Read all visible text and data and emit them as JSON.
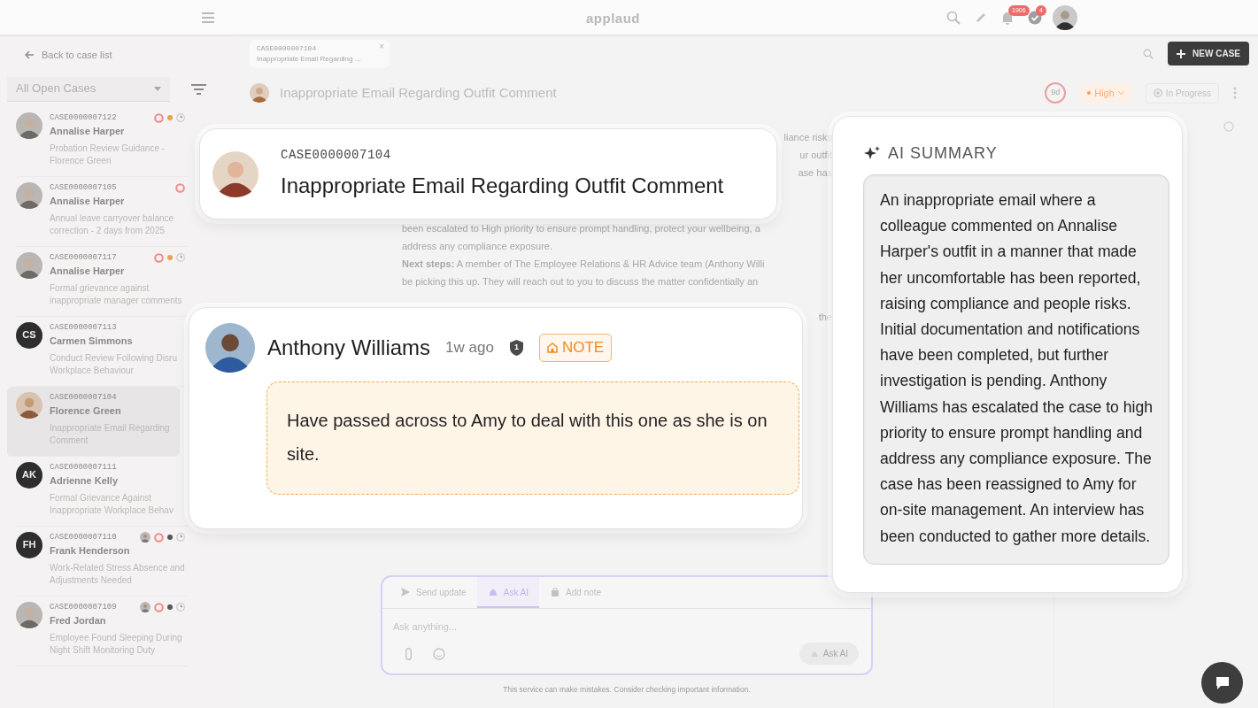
{
  "topbar": {
    "logo": "applaud",
    "notification_count": "1906",
    "task_count": "4"
  },
  "sidebar": {
    "back_link": "Back to case list",
    "filter": "All Open Cases",
    "cases": [
      {
        "case_number": "CASE0000007122",
        "name": "Annalise Harper",
        "description_lines": [
          "Probation Review Guidance -",
          "Florence Green"
        ],
        "avatar": {
          "kind": "photo"
        },
        "selected": false,
        "markers": [
          {
            "kind": "ring"
          },
          {
            "kind": "dot",
            "color": "#f0a04b"
          },
          {
            "kind": "clock"
          }
        ]
      },
      {
        "case_number": "CASE0000007105",
        "name": "Annalise Harper",
        "description_lines": [
          "Annual leave carryover balance",
          "correction - 2 days from 2025"
        ],
        "avatar": {
          "kind": "photo"
        },
        "selected": false,
        "markers": [
          {
            "kind": "ring"
          }
        ]
      },
      {
        "case_number": "CASE0000007117",
        "name": "Annalise Harper",
        "description_lines": [
          "Formal grievance against",
          "inappropriate manager comments"
        ],
        "avatar": {
          "kind": "photo"
        },
        "selected": false,
        "markers": [
          {
            "kind": "ring"
          },
          {
            "kind": "dot",
            "color": "#f0a04b"
          },
          {
            "kind": "clock"
          }
        ]
      },
      {
        "case_number": "CASE0000007113",
        "name": "Carmen Simmons",
        "description_lines": [
          "Conduct Review Following Disru",
          "Workplace Behaviour"
        ],
        "avatar": {
          "kind": "initials",
          "text": "CS"
        },
        "selected": false
      },
      {
        "case_number": "CASE0000007104",
        "name": "Florence Green",
        "description_lines": [
          "Inappropriate Email Regarding",
          "Comment"
        ],
        "avatar": {
          "kind": "photo"
        },
        "selected": true
      },
      {
        "case_number": "CASE0000007111",
        "name": "Adrienne Kelly",
        "description_lines": [
          "Formal Grievance Against",
          "Inappropriate Workplace Behav"
        ],
        "avatar": {
          "kind": "initials",
          "text": "AK"
        },
        "selected": false
      },
      {
        "case_number": "CASE0000007110",
        "name": "Frank Henderson",
        "description_lines": [
          "Work-Related Stress Absence and",
          "Adjustments Needed"
        ],
        "avatar": {
          "kind": "initials",
          "text": "FH"
        },
        "selected": false,
        "markers": [
          {
            "kind": "person"
          },
          {
            "kind": "ring"
          },
          {
            "kind": "dot",
            "color": "#555555"
          },
          {
            "kind": "clock"
          }
        ]
      },
      {
        "case_number": "CASE0000007109",
        "name": "Fred Jordan",
        "description_lines": [
          "Employee Found Sleeping During",
          "Night Shift Monitoring Duty"
        ],
        "avatar": {
          "kind": "photo"
        },
        "selected": false,
        "markers": [
          {
            "kind": "person"
          },
          {
            "kind": "ring"
          },
          {
            "kind": "dot",
            "color": "#555555"
          },
          {
            "kind": "clock"
          }
        ]
      }
    ]
  },
  "tab": {
    "case_number": "CASE0000007104",
    "title": "Inappropriate Email Regarding ...",
    "close": "×"
  },
  "new_case_button": "NEW CASE",
  "case_header": {
    "title": "Inappropriate Email Regarding Outfit Comment",
    "age": "9d",
    "priority": "High",
    "status": "In Progress"
  },
  "message_lines": [
    {
      "kind": "fragment",
      "text": "liance risks"
    },
    {
      "kind": "fragment",
      "text": "ur outfit"
    },
    {
      "kind": "fragment",
      "text": "ase has"
    },
    {
      "kind": "line",
      "text": "been escalated to High priority to ensure prompt handling, protect your wellbeing, a"
    },
    {
      "kind": "line",
      "text": "address any compliance exposure."
    },
    {
      "kind": "line",
      "text": "**Next steps:** A member of The Employee Relations & HR Advice team (Anthony Willi"
    },
    {
      "kind": "line",
      "text": "be picking this up. They will reach out to you to discuss the matter confidentially an"
    },
    {
      "kind": "fragment",
      "text": "the"
    }
  ],
  "composer": {
    "tabs": [
      {
        "label": "Send update",
        "selected": false
      },
      {
        "label": "Ask AI",
        "selected": true
      },
      {
        "label": "Add note",
        "selected": false
      }
    ],
    "placeholder": "Ask anything...",
    "submit": {
      "label": "Ask AI",
      "disabled": true
    }
  },
  "disclaimer": "This service can make mistakes. Consider checking important information.",
  "case_card": {
    "case_number": "CASE0000007104",
    "title": "Inappropriate Email Regarding Outfit Comment"
  },
  "note_card": {
    "author": "Anthony Williams",
    "time": "1w ago",
    "badge": "1",
    "tag": "NOTE",
    "text": "Have passed across to Amy to deal with this one as she is on site."
  },
  "ai_summary": {
    "heading": "AI SUMMARY",
    "text": "An inappropriate email where a colleague commented on Annalise Harper's outfit in a manner that made her uncomfortable has been reported, raising compliance and people risks. Initial documentation and notifications have been completed, but further investigation is pending. Anthony Williams has escalated the case to high priority to ensure prompt handling and address any compliance exposure. The case has been reassigned to Amy for on-site management. An interview has been conducted to gather more details."
  }
}
